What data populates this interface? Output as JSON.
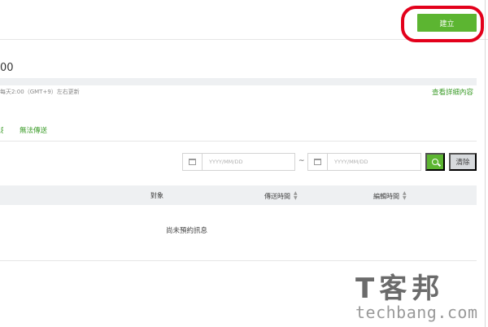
{
  "header": {
    "create_label": "建立"
  },
  "page": {
    "heading": "00",
    "info_text": "每天2:00（GMT+9）左右更新",
    "detail_link": "查看詳細內容"
  },
  "tabs": [
    {
      "label": "息"
    },
    {
      "label": "無法傳送"
    }
  ],
  "filters": {
    "start_date_placeholder": "YYYY/MM/DD",
    "separator": "~",
    "end_date_placeholder": "YYYY/MM/DD",
    "clear_label": "清除"
  },
  "table": {
    "columns": [
      "對象",
      "傳送時間",
      "編輯時間"
    ],
    "empty_message": "尚未預約訊息"
  },
  "watermark": {
    "logo": "T客邦",
    "site": "techbang.com"
  },
  "colors": {
    "accent": "#5cb531",
    "highlight": "#e3001b"
  },
  "icons": [
    "calendar-icon",
    "search-icon",
    "sort-icon"
  ]
}
